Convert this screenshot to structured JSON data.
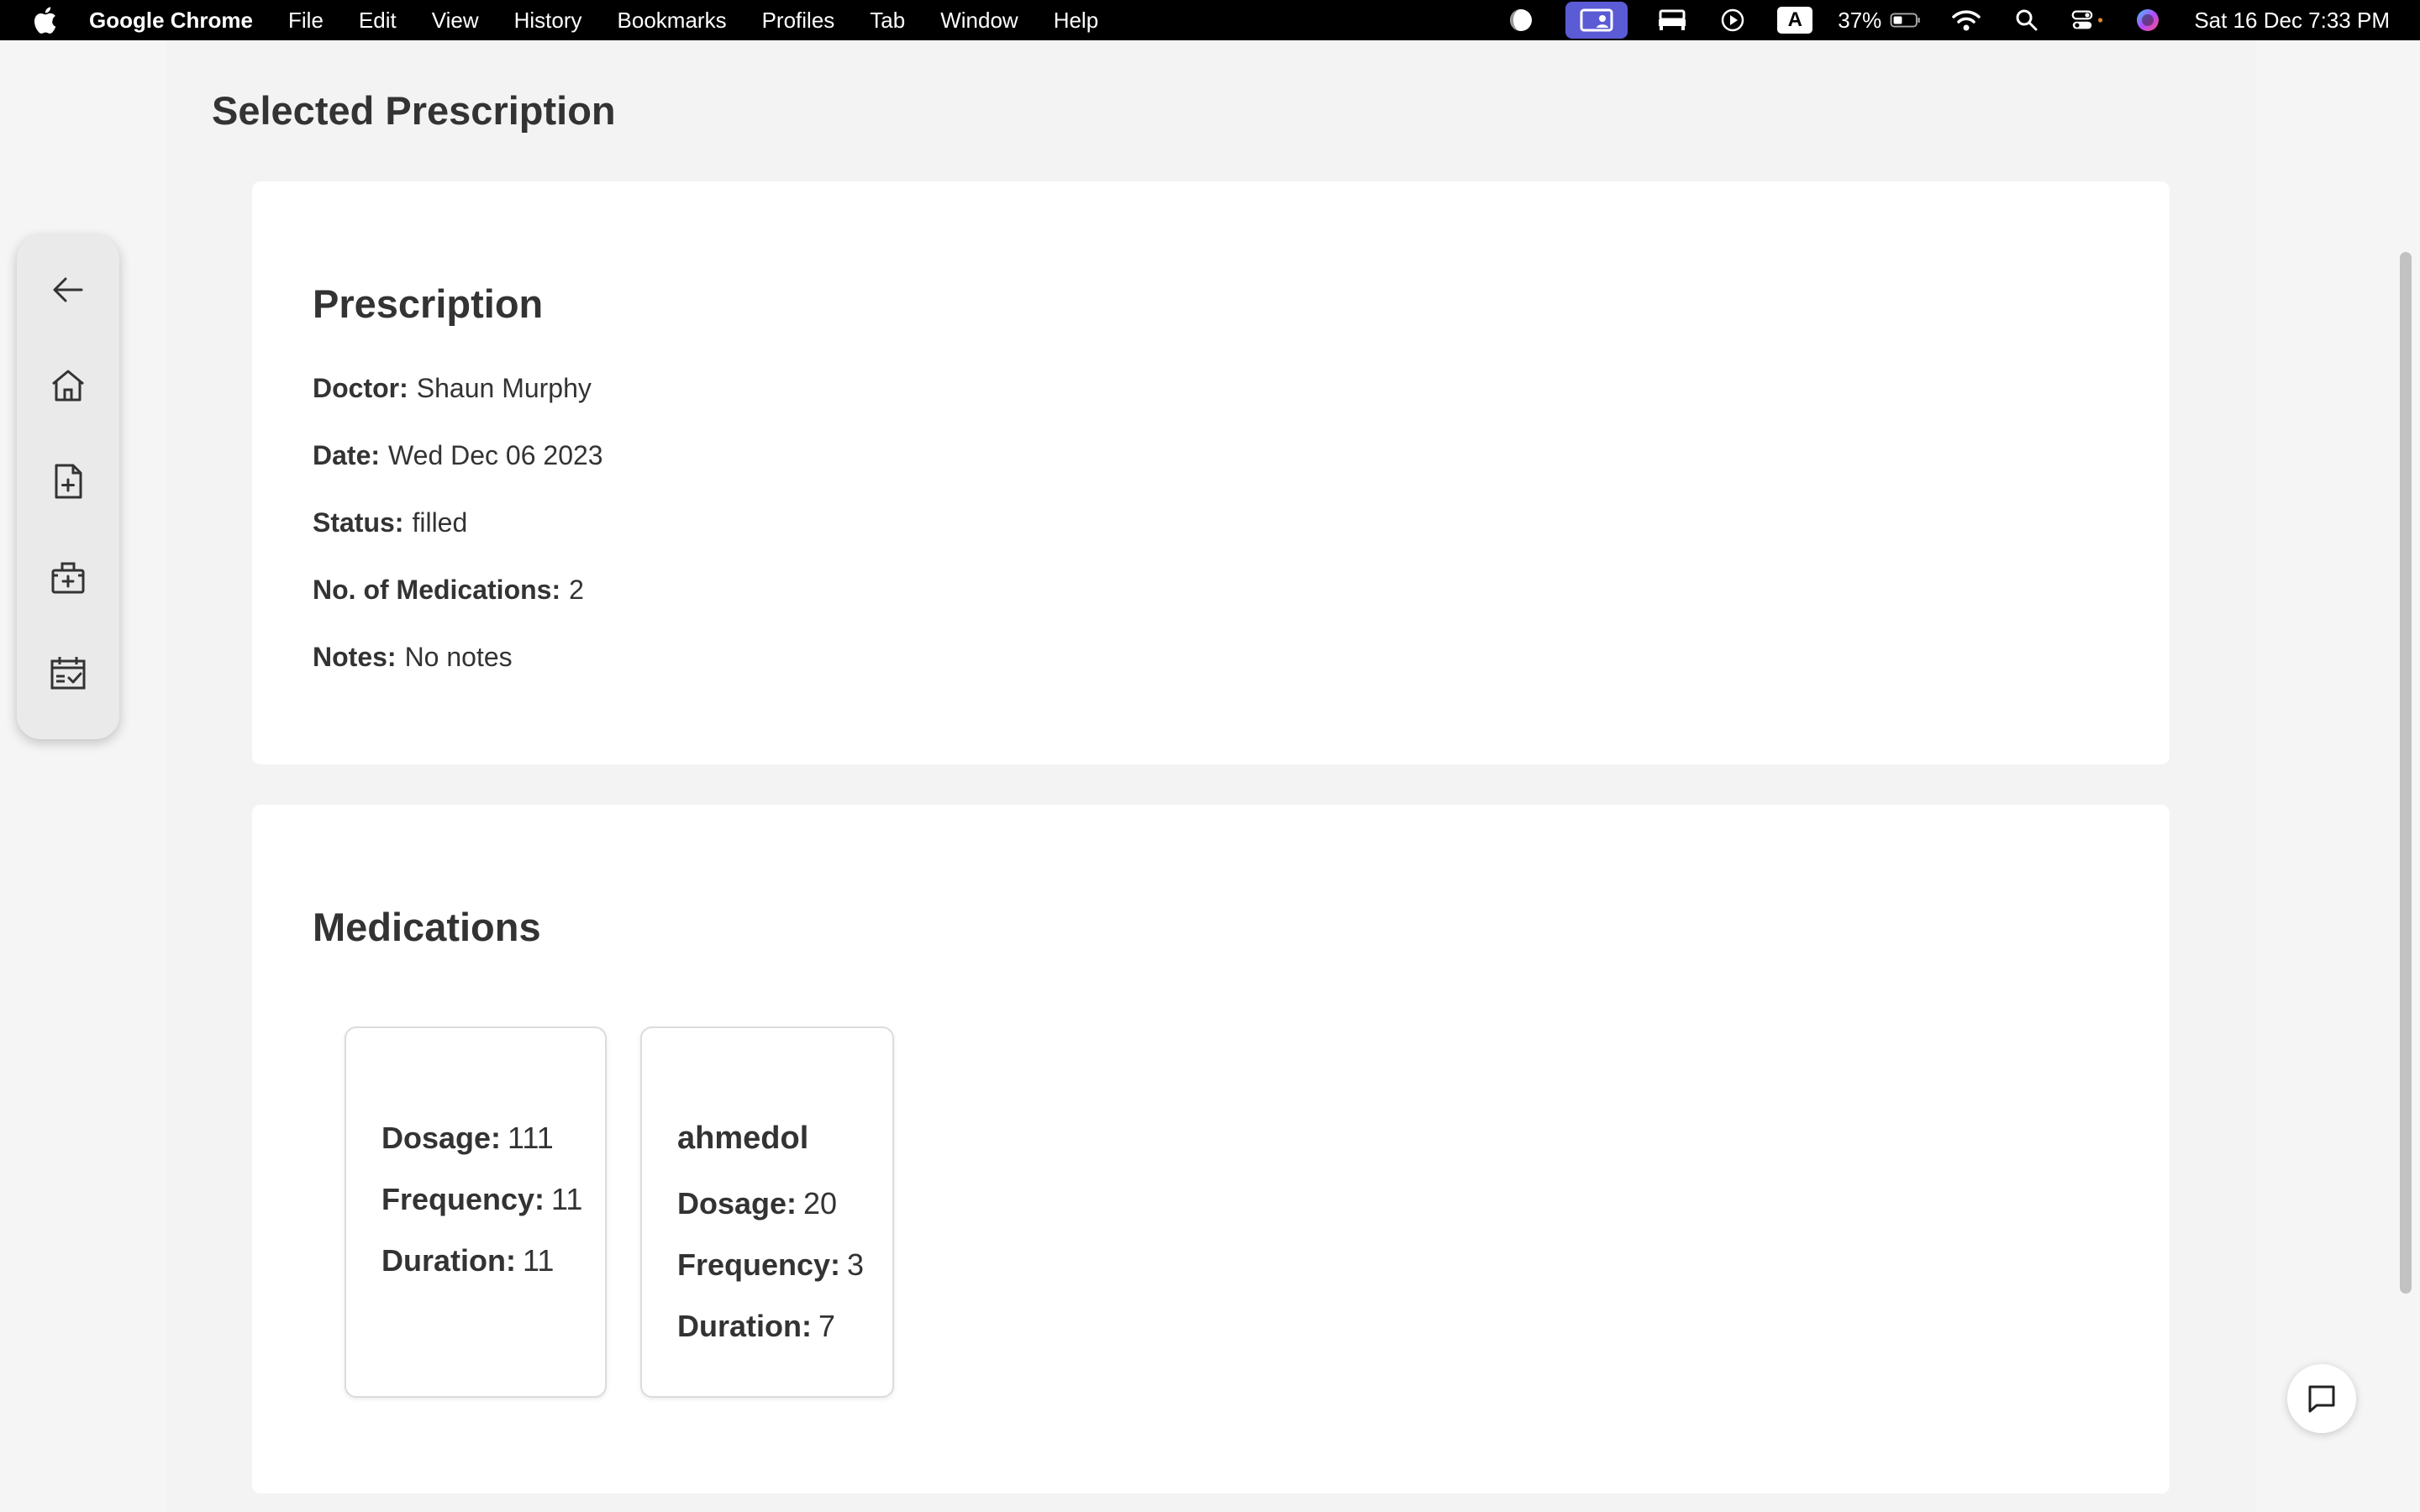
{
  "menubar": {
    "app_name": "Google Chrome",
    "menus": [
      "File",
      "Edit",
      "View",
      "History",
      "Bookmarks",
      "Profiles",
      "Tab",
      "Window",
      "Help"
    ],
    "battery": "37%",
    "kbd_letter": "A",
    "datetime": "Sat 16 Dec  7:33 PM"
  },
  "page": {
    "title": "Selected Prescription"
  },
  "sidebar": {
    "items": [
      "back-arrow-icon",
      "home-icon",
      "add-document-icon",
      "medical-kit-icon",
      "calendar-check-icon"
    ]
  },
  "prescription": {
    "heading": "Prescription",
    "doctor_label": "Doctor:",
    "doctor": "Shaun Murphy",
    "date_label": "Date:",
    "date": "Wed Dec 06 2023",
    "status_label": "Status:",
    "status": "filled",
    "count_label": "No. of Medications:",
    "count": "2",
    "notes_label": "Notes:",
    "notes": "No notes"
  },
  "medications": {
    "heading": "Medications",
    "labels": {
      "dosage": "Dosage:",
      "frequency": "Frequency:",
      "duration": "Duration:"
    },
    "items": [
      {
        "name": "",
        "dosage": "111",
        "frequency": "11",
        "duration": "11"
      },
      {
        "name": "ahmedol",
        "dosage": "20",
        "frequency": "3",
        "duration": "7"
      }
    ]
  },
  "colors": {
    "accent_active": "#5b5bd6",
    "card_bg": "#ffffff",
    "page_bg": "#f3f3f3"
  }
}
